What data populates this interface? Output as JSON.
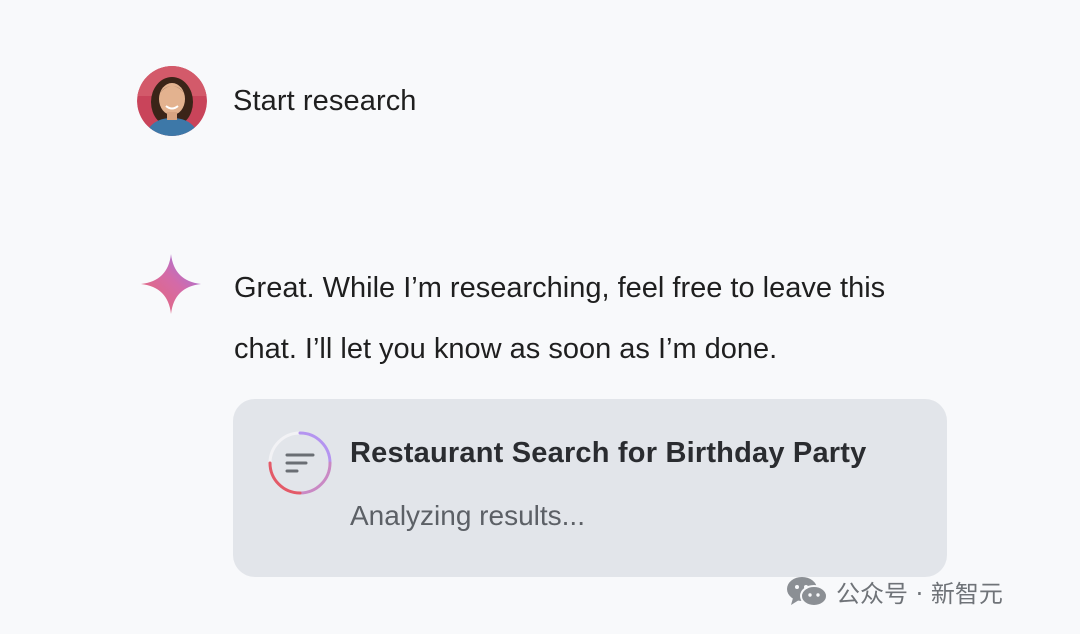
{
  "user": {
    "message": "Start research",
    "avatar_icon": "user-avatar-photo"
  },
  "assistant": {
    "icon": "gemini-sparkle-icon",
    "message": "Great. While I’m researching, feel free to leave this chat. I’ll let you know as soon as I’m done."
  },
  "research_card": {
    "title": "Restaurant Search for Birthday Party",
    "status": "Analyzing results...",
    "icon": "list-progress-icon"
  },
  "watermark": {
    "icon": "wechat-icon",
    "text": "公众号 · 新智元"
  },
  "colors": {
    "background": "#f8f9fb",
    "card_background": "#e2e5ea",
    "sparkle_start": "#e8676f",
    "sparkle_end": "#8f7bf0",
    "ring_red": "#e35a68",
    "ring_purple": "#b494f0"
  }
}
